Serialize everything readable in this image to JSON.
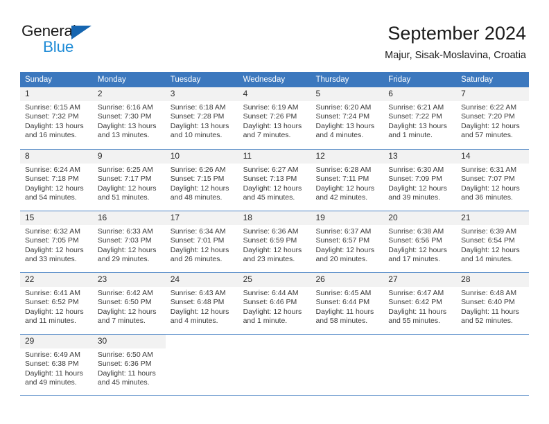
{
  "brand": {
    "name_top": "General",
    "name_bottom": "Blue",
    "triangle_color": "#1565b0",
    "blue_text_color": "#1e8bd6"
  },
  "header": {
    "title": "September 2024",
    "subtitle": "Majur, Sisak-Moslavina, Croatia"
  },
  "theme": {
    "header_blue": "#3c78be",
    "daynum_band": "#f2f2f2",
    "grid_line": "#4a83c4",
    "text": "#3a3a3a"
  },
  "weekdays": [
    "Sunday",
    "Monday",
    "Tuesday",
    "Wednesday",
    "Thursday",
    "Friday",
    "Saturday"
  ],
  "weeks": [
    [
      {
        "day": "1",
        "sunrise": "Sunrise: 6:15 AM",
        "sunset": "Sunset: 7:32 PM",
        "daylight1": "Daylight: 13 hours",
        "daylight2": "and 16 minutes."
      },
      {
        "day": "2",
        "sunrise": "Sunrise: 6:16 AM",
        "sunset": "Sunset: 7:30 PM",
        "daylight1": "Daylight: 13 hours",
        "daylight2": "and 13 minutes."
      },
      {
        "day": "3",
        "sunrise": "Sunrise: 6:18 AM",
        "sunset": "Sunset: 7:28 PM",
        "daylight1": "Daylight: 13 hours",
        "daylight2": "and 10 minutes."
      },
      {
        "day": "4",
        "sunrise": "Sunrise: 6:19 AM",
        "sunset": "Sunset: 7:26 PM",
        "daylight1": "Daylight: 13 hours",
        "daylight2": "and 7 minutes."
      },
      {
        "day": "5",
        "sunrise": "Sunrise: 6:20 AM",
        "sunset": "Sunset: 7:24 PM",
        "daylight1": "Daylight: 13 hours",
        "daylight2": "and 4 minutes."
      },
      {
        "day": "6",
        "sunrise": "Sunrise: 6:21 AM",
        "sunset": "Sunset: 7:22 PM",
        "daylight1": "Daylight: 13 hours",
        "daylight2": "and 1 minute."
      },
      {
        "day": "7",
        "sunrise": "Sunrise: 6:22 AM",
        "sunset": "Sunset: 7:20 PM",
        "daylight1": "Daylight: 12 hours",
        "daylight2": "and 57 minutes."
      }
    ],
    [
      {
        "day": "8",
        "sunrise": "Sunrise: 6:24 AM",
        "sunset": "Sunset: 7:18 PM",
        "daylight1": "Daylight: 12 hours",
        "daylight2": "and 54 minutes."
      },
      {
        "day": "9",
        "sunrise": "Sunrise: 6:25 AM",
        "sunset": "Sunset: 7:17 PM",
        "daylight1": "Daylight: 12 hours",
        "daylight2": "and 51 minutes."
      },
      {
        "day": "10",
        "sunrise": "Sunrise: 6:26 AM",
        "sunset": "Sunset: 7:15 PM",
        "daylight1": "Daylight: 12 hours",
        "daylight2": "and 48 minutes."
      },
      {
        "day": "11",
        "sunrise": "Sunrise: 6:27 AM",
        "sunset": "Sunset: 7:13 PM",
        "daylight1": "Daylight: 12 hours",
        "daylight2": "and 45 minutes."
      },
      {
        "day": "12",
        "sunrise": "Sunrise: 6:28 AM",
        "sunset": "Sunset: 7:11 PM",
        "daylight1": "Daylight: 12 hours",
        "daylight2": "and 42 minutes."
      },
      {
        "day": "13",
        "sunrise": "Sunrise: 6:30 AM",
        "sunset": "Sunset: 7:09 PM",
        "daylight1": "Daylight: 12 hours",
        "daylight2": "and 39 minutes."
      },
      {
        "day": "14",
        "sunrise": "Sunrise: 6:31 AM",
        "sunset": "Sunset: 7:07 PM",
        "daylight1": "Daylight: 12 hours",
        "daylight2": "and 36 minutes."
      }
    ],
    [
      {
        "day": "15",
        "sunrise": "Sunrise: 6:32 AM",
        "sunset": "Sunset: 7:05 PM",
        "daylight1": "Daylight: 12 hours",
        "daylight2": "and 33 minutes."
      },
      {
        "day": "16",
        "sunrise": "Sunrise: 6:33 AM",
        "sunset": "Sunset: 7:03 PM",
        "daylight1": "Daylight: 12 hours",
        "daylight2": "and 29 minutes."
      },
      {
        "day": "17",
        "sunrise": "Sunrise: 6:34 AM",
        "sunset": "Sunset: 7:01 PM",
        "daylight1": "Daylight: 12 hours",
        "daylight2": "and 26 minutes."
      },
      {
        "day": "18",
        "sunrise": "Sunrise: 6:36 AM",
        "sunset": "Sunset: 6:59 PM",
        "daylight1": "Daylight: 12 hours",
        "daylight2": "and 23 minutes."
      },
      {
        "day": "19",
        "sunrise": "Sunrise: 6:37 AM",
        "sunset": "Sunset: 6:57 PM",
        "daylight1": "Daylight: 12 hours",
        "daylight2": "and 20 minutes."
      },
      {
        "day": "20",
        "sunrise": "Sunrise: 6:38 AM",
        "sunset": "Sunset: 6:56 PM",
        "daylight1": "Daylight: 12 hours",
        "daylight2": "and 17 minutes."
      },
      {
        "day": "21",
        "sunrise": "Sunrise: 6:39 AM",
        "sunset": "Sunset: 6:54 PM",
        "daylight1": "Daylight: 12 hours",
        "daylight2": "and 14 minutes."
      }
    ],
    [
      {
        "day": "22",
        "sunrise": "Sunrise: 6:41 AM",
        "sunset": "Sunset: 6:52 PM",
        "daylight1": "Daylight: 12 hours",
        "daylight2": "and 11 minutes."
      },
      {
        "day": "23",
        "sunrise": "Sunrise: 6:42 AM",
        "sunset": "Sunset: 6:50 PM",
        "daylight1": "Daylight: 12 hours",
        "daylight2": "and 7 minutes."
      },
      {
        "day": "24",
        "sunrise": "Sunrise: 6:43 AM",
        "sunset": "Sunset: 6:48 PM",
        "daylight1": "Daylight: 12 hours",
        "daylight2": "and 4 minutes."
      },
      {
        "day": "25",
        "sunrise": "Sunrise: 6:44 AM",
        "sunset": "Sunset: 6:46 PM",
        "daylight1": "Daylight: 12 hours",
        "daylight2": "and 1 minute."
      },
      {
        "day": "26",
        "sunrise": "Sunrise: 6:45 AM",
        "sunset": "Sunset: 6:44 PM",
        "daylight1": "Daylight: 11 hours",
        "daylight2": "and 58 minutes."
      },
      {
        "day": "27",
        "sunrise": "Sunrise: 6:47 AM",
        "sunset": "Sunset: 6:42 PM",
        "daylight1": "Daylight: 11 hours",
        "daylight2": "and 55 minutes."
      },
      {
        "day": "28",
        "sunrise": "Sunrise: 6:48 AM",
        "sunset": "Sunset: 6:40 PM",
        "daylight1": "Daylight: 11 hours",
        "daylight2": "and 52 minutes."
      }
    ],
    [
      {
        "day": "29",
        "sunrise": "Sunrise: 6:49 AM",
        "sunset": "Sunset: 6:38 PM",
        "daylight1": "Daylight: 11 hours",
        "daylight2": "and 49 minutes."
      },
      {
        "day": "30",
        "sunrise": "Sunrise: 6:50 AM",
        "sunset": "Sunset: 6:36 PM",
        "daylight1": "Daylight: 11 hours",
        "daylight2": "and 45 minutes."
      },
      {
        "day": "",
        "sunrise": "",
        "sunset": "",
        "daylight1": "",
        "daylight2": ""
      },
      {
        "day": "",
        "sunrise": "",
        "sunset": "",
        "daylight1": "",
        "daylight2": ""
      },
      {
        "day": "",
        "sunrise": "",
        "sunset": "",
        "daylight1": "",
        "daylight2": ""
      },
      {
        "day": "",
        "sunrise": "",
        "sunset": "",
        "daylight1": "",
        "daylight2": ""
      },
      {
        "day": "",
        "sunrise": "",
        "sunset": "",
        "daylight1": "",
        "daylight2": ""
      }
    ]
  ]
}
